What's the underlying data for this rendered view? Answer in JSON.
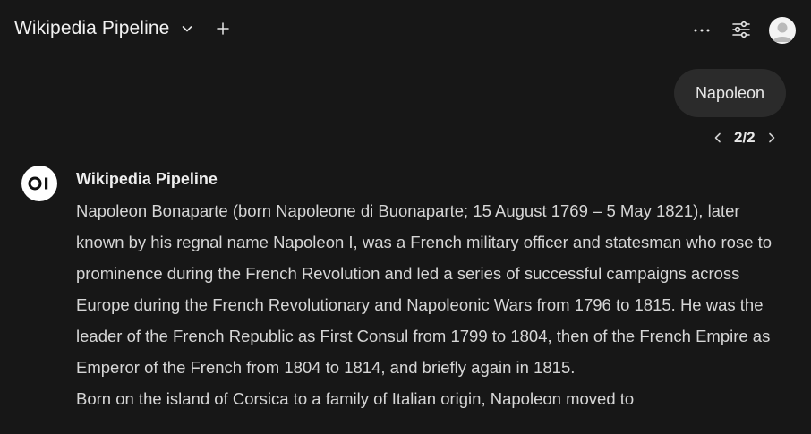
{
  "header": {
    "model_name": "Wikipedia Pipeline",
    "icons": {
      "dropdown": "chevron-down-icon",
      "new_chat": "plus-icon",
      "more": "more-horizontal-icon",
      "controls": "sliders-icon",
      "avatar": "user-avatar"
    }
  },
  "user_message": {
    "text": "Napoleon"
  },
  "pager": {
    "label": "2/2"
  },
  "assistant": {
    "name": "Wikipedia Pipeline",
    "paragraphs": [
      "Napoleon Bonaparte (born Napoleone di Buonaparte; 15 August 1769 – 5 May 1821), later known by his regnal name Napoleon I, was a French military officer and statesman who rose to prominence during the French Revolution and led a series of successful campaigns across Europe during the French Revolutionary and Napoleonic Wars from 1796 to 1815. He was the leader of the French Republic as First Consul from 1799 to 1804, then of the French Empire as Emperor of the French from 1804 to 1814, and briefly again in 1815.",
      "Born on the island of Corsica to a family of Italian origin, Napoleon moved to"
    ]
  },
  "colors": {
    "background": "#171717",
    "bubble": "#2b2b2b",
    "text": "#d6d6d6"
  }
}
